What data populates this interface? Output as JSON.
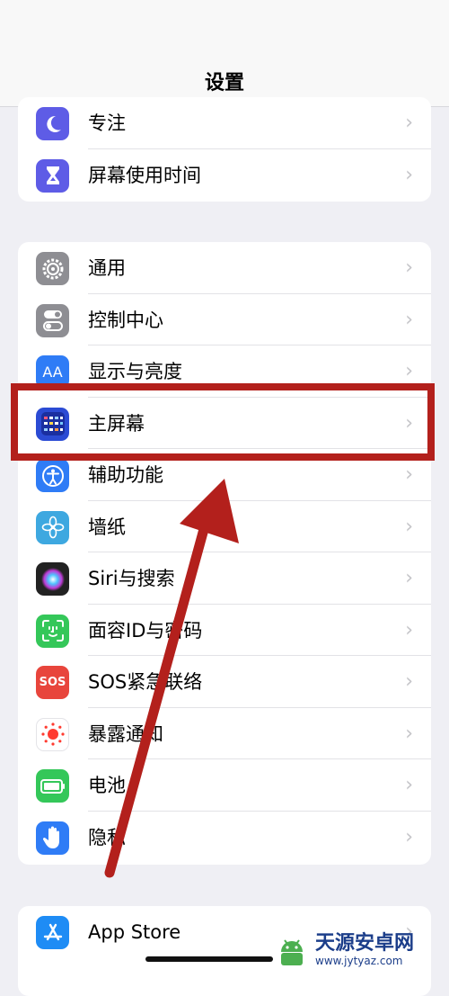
{
  "header": {
    "title": "设置"
  },
  "groups": [
    {
      "items": [
        {
          "label": "专注",
          "icon": "moon-icon",
          "color": "#5e5ce6"
        },
        {
          "label": "屏幕使用时间",
          "icon": "hourglass-icon",
          "color": "#5e5ce6"
        }
      ]
    },
    {
      "items": [
        {
          "label": "通用",
          "icon": "gear-icon",
          "color": "#8e8e93"
        },
        {
          "label": "控制中心",
          "icon": "toggles-icon",
          "color": "#8e8e93"
        },
        {
          "label": "显示与亮度",
          "icon": "text-size-icon",
          "glyph": "AA",
          "color": "#2f7cf6"
        },
        {
          "label": "主屏幕",
          "icon": "home-screen-icon",
          "color": "#2b4bd4"
        },
        {
          "label": "辅助功能",
          "icon": "accessibility-icon",
          "color": "#2f7cf6"
        },
        {
          "label": "墙纸",
          "icon": "flower-icon",
          "color": "#3ea8e0"
        },
        {
          "label": "Siri与搜索",
          "icon": "siri-icon",
          "color": "#222222"
        },
        {
          "label": "面容ID与密码",
          "icon": "face-id-icon",
          "color": "#34c759"
        },
        {
          "label": "SOS紧急联络",
          "icon": "sos-icon",
          "glyph": "SOS",
          "color": "#e8453c"
        },
        {
          "label": "暴露通知",
          "icon": "exposure-icon",
          "color": "#ffffff"
        },
        {
          "label": "电池",
          "icon": "battery-icon",
          "color": "#34c759"
        },
        {
          "label": "隐私",
          "icon": "hand-icon",
          "color": "#2f7cf6"
        }
      ]
    },
    {
      "items": [
        {
          "label": "App Store",
          "icon": "app-store-icon",
          "color": "#1e8cf5"
        }
      ]
    }
  ],
  "chevron": "›",
  "watermark": {
    "title": "天源安卓网",
    "url": "www.jytyaz.com"
  },
  "annotation_color": "#b3201c"
}
